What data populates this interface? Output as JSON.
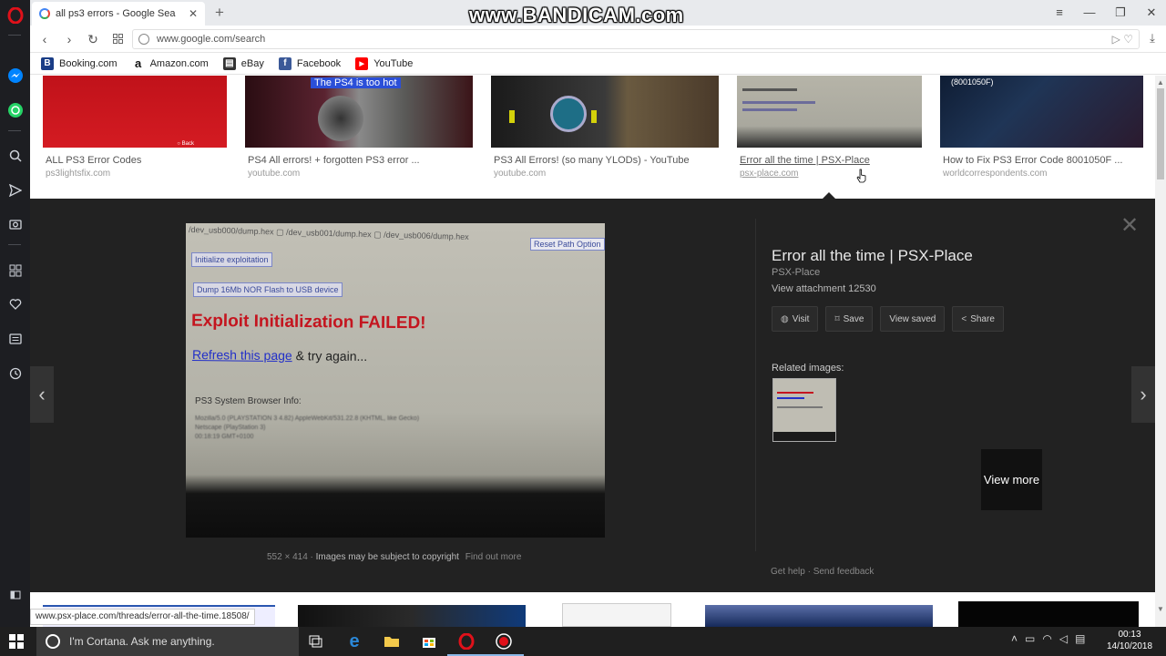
{
  "watermark": "www.BANDICAM.com",
  "browser": {
    "tab_title": "all ps3 errors - Google Sea",
    "url": "www.google.com/search",
    "status_url": "www.psx-place.com/threads/error-all-the-time.18508/"
  },
  "bookmarks": [
    {
      "label": "Booking.com",
      "icon": "booking-icon",
      "color": "#1a3d86"
    },
    {
      "label": "Amazon.com",
      "icon": "amazon-icon",
      "color": "#111111"
    },
    {
      "label": "eBay",
      "icon": "ebay-icon",
      "color": "#e53238"
    },
    {
      "label": "Facebook",
      "icon": "facebook-icon",
      "color": "#3b5998"
    },
    {
      "label": "YouTube",
      "icon": "youtube-icon",
      "color": "#ff0000"
    }
  ],
  "results": [
    {
      "caption": "ALL PS3 Error Codes",
      "source": "ps3lightsfix.com"
    },
    {
      "caption": "PS4 All errors! + forgotten PS3 error ...",
      "source": "youtube.com",
      "overlay": "The PS4 is too hot"
    },
    {
      "caption": "PS3 All Errors! (so many YLODs) - YouTube",
      "source": "youtube.com"
    },
    {
      "caption": "Error all the time | PSX-Place",
      "source": "psx-place.com"
    },
    {
      "caption": "How to Fix PS3 Error Code 8001050F ...",
      "source": "worldcorrespondents.com",
      "overlay": "(8001050F)"
    }
  ],
  "viewer": {
    "title": "Error all the time | PSX-Place",
    "site": "PSX-Place",
    "attachment": "View attachment 12530",
    "actions": {
      "visit": "Visit",
      "save": "Save",
      "view_saved": "View saved",
      "share": "Share"
    },
    "related_label": "Related images:",
    "view_more": "View more",
    "dimensions": "552 × 414",
    "copyright": "Images may be subject to copyright",
    "find_out_more": "Find out more",
    "get_help": "Get help",
    "send_feedback": "Send feedback",
    "image_text": {
      "line1": "/dev_usb000/dump.hex",
      "line1b": "/dev_usb001/dump.hex",
      "line1c": "/dev_usb006/dump.hex",
      "reset": "Reset Path Option",
      "init_btn": "Initialize exploitation",
      "dump_btn": "Dump 16Mb NOR Flash to USB device",
      "failed": "Exploit Initialization FAILED!",
      "refresh": "Refresh this page",
      "try_again": "& try again...",
      "sys_info": "PS3 System Browser Info:",
      "ua1": "Mozilla/5.0 (PLAYSTATION 3 4.82) AppleWebKit/531.22.8 (KHTML, like Gecko)",
      "ua2": "Netscape (PlayStation 3)",
      "ua3": "00:18:19 GMT+0100"
    }
  },
  "taskbar": {
    "cortana": "I'm Cortana. Ask me anything.",
    "time": "00:13",
    "date": "14/10/2018"
  },
  "colors": {
    "opera_red": "#e0111a",
    "viewer_bg": "#222222",
    "link_blue": "#1a0dab"
  }
}
